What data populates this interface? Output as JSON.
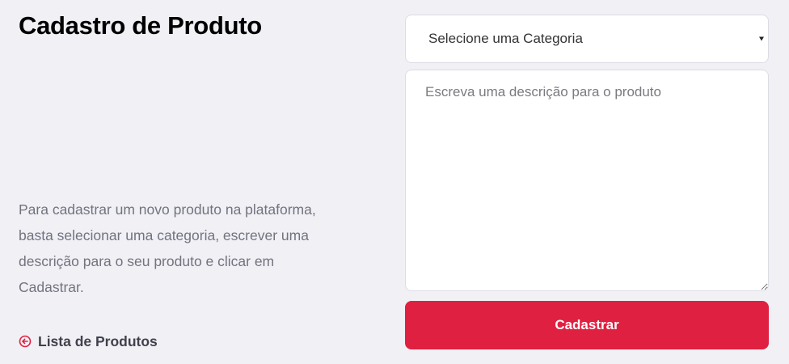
{
  "page": {
    "title": "Cadastro de Produto",
    "description": "Para cadastrar um novo produto na plataforma, basta selecionar uma categoria, escrever uma descrição para o seu produto e clicar em Cadastrar.",
    "back_link": {
      "label": "Lista de Produtos",
      "icon": "arrow-left-circle-icon"
    }
  },
  "form": {
    "category_select": {
      "selected": "Selecione uma Categoria"
    },
    "description_field": {
      "placeholder": "Escreva uma descrição para o produto",
      "value": ""
    },
    "submit_label": "Cadastrar"
  },
  "colors": {
    "background": "#f0f0f5",
    "accent": "#e02041",
    "text_muted": "#737380",
    "text_dark": "#41414d",
    "field_border": "#dcdce6"
  }
}
